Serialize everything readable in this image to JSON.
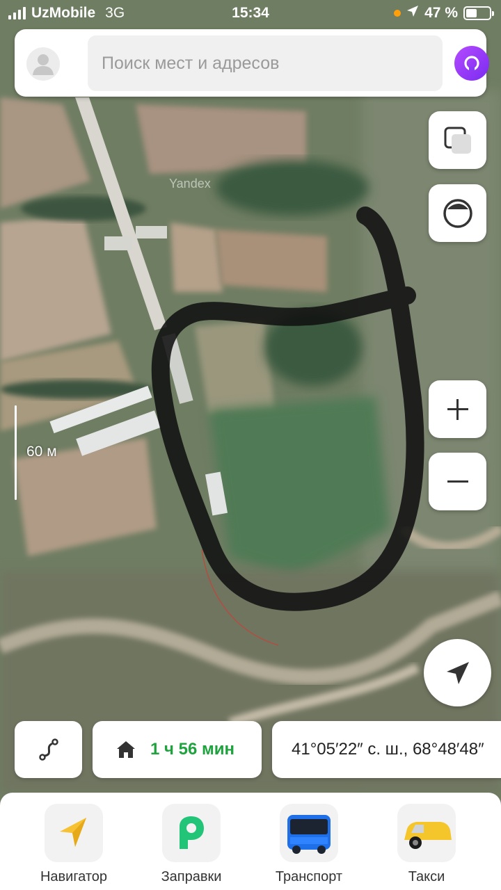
{
  "status_bar": {
    "carrier": "UzMobile",
    "network": "3G",
    "time": "15:34",
    "battery": "47 %",
    "battery_level": 0.47
  },
  "search": {
    "placeholder": "Поиск мест и адресов"
  },
  "map": {
    "watermark": "Yandex",
    "scale_label": "60 м",
    "route_color": "#111111"
  },
  "chips": {
    "home_eta": "1 ч 56 мин",
    "coordinates": "41°05′22″ с. ш., 68°48′48″"
  },
  "services": [
    {
      "label": "Навигатор",
      "icon": "navigator-arrow-icon"
    },
    {
      "label": "Заправки",
      "icon": "fuel-p-icon"
    },
    {
      "label": "Транспорт",
      "icon": "bus-icon"
    },
    {
      "label": "Такси",
      "icon": "taxi-car-icon"
    }
  ],
  "colors": {
    "accent_green": "#1fa33f",
    "alice_purple": "#8a3cf5"
  }
}
